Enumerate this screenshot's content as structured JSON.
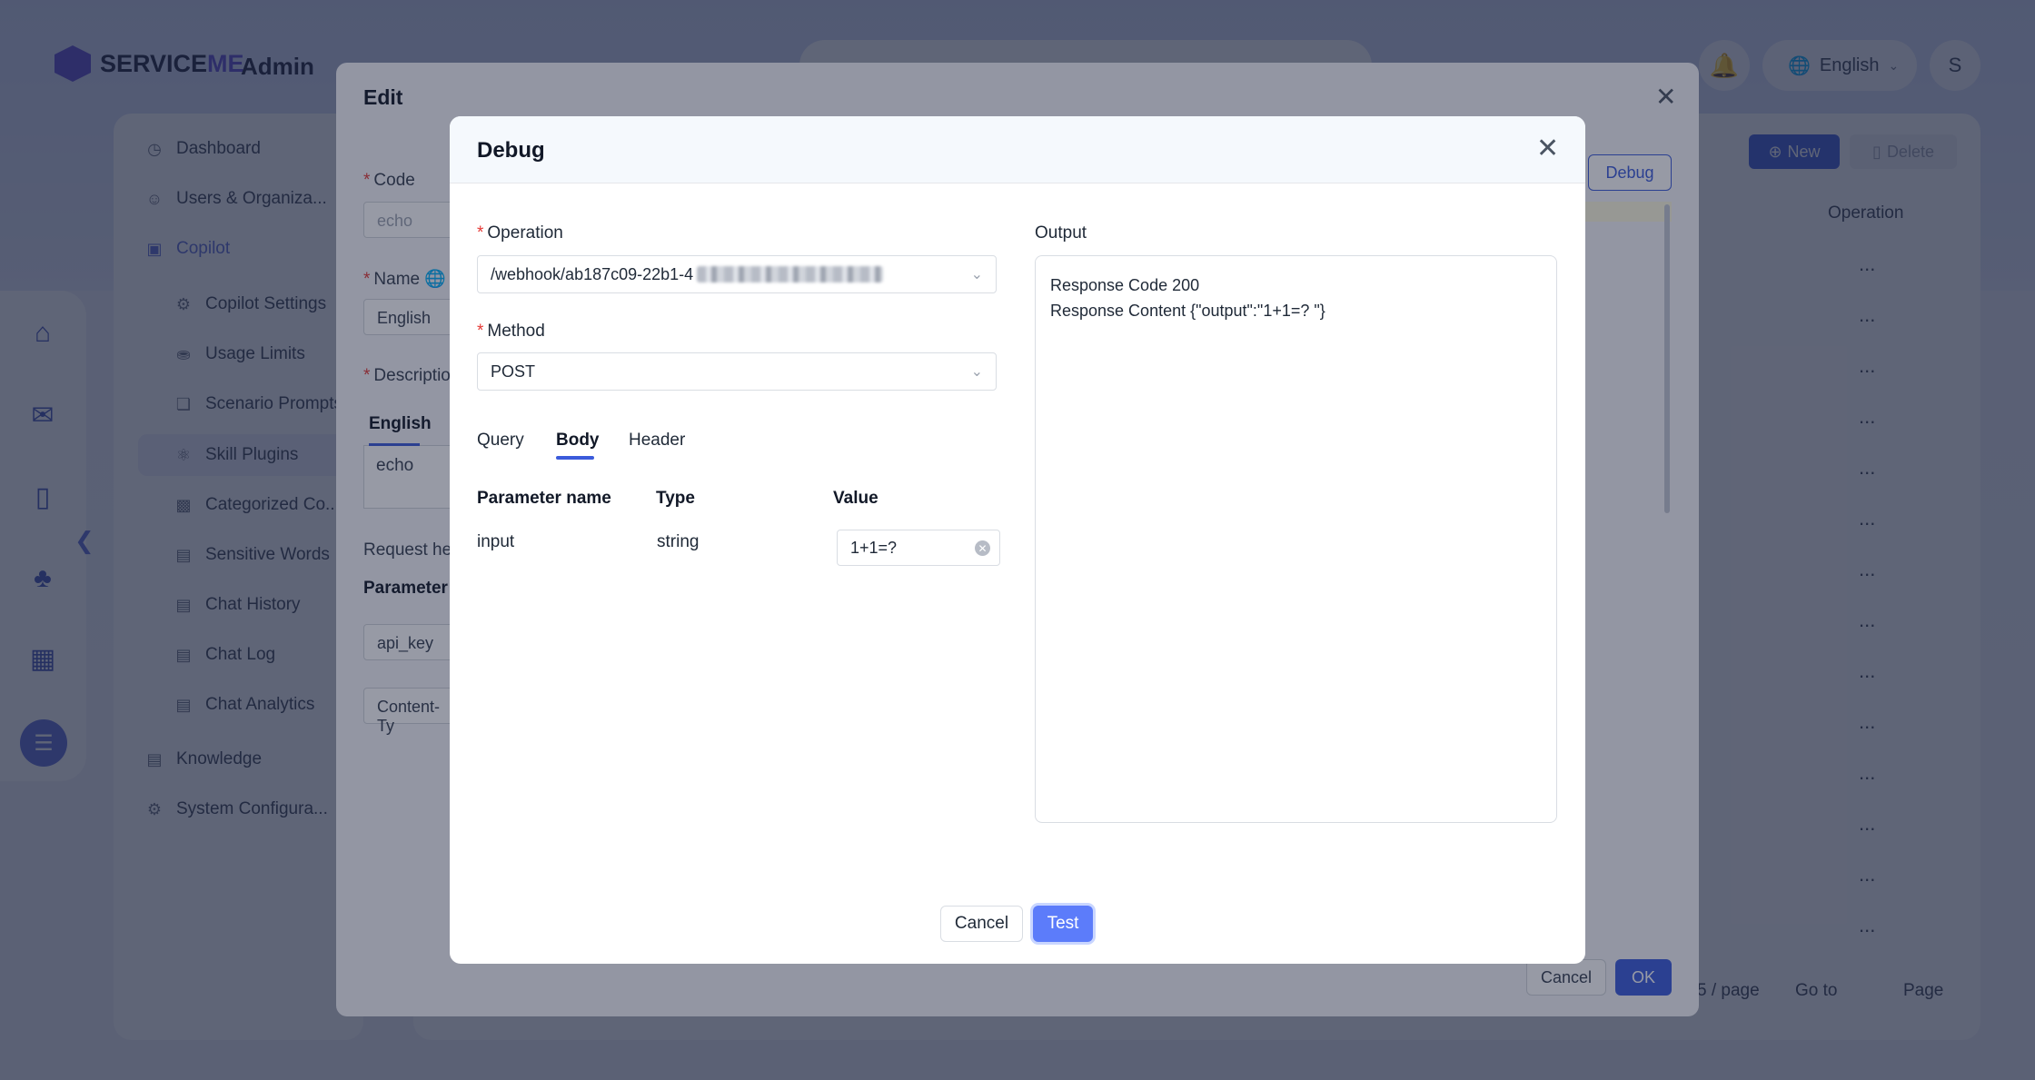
{
  "app": {
    "logo_prefix": "SERVICE",
    "logo_suffix": "ME",
    "admin_label": "Admin",
    "language": "English",
    "avatar_initial": "S"
  },
  "sidebar": {
    "items": [
      {
        "label": "Dashboard",
        "icon": "dashboard-icon"
      },
      {
        "label": "Users & Organiza...",
        "icon": "users-icon"
      },
      {
        "label": "Copilot",
        "icon": "copilot-icon"
      },
      {
        "label": "Copilot Settings",
        "icon": "settings-icon"
      },
      {
        "label": "Usage Limits",
        "icon": "lock-icon"
      },
      {
        "label": "Scenario Prompts",
        "icon": "prompt-icon"
      },
      {
        "label": "Skill Plugins",
        "icon": "plugin-icon"
      },
      {
        "label": "Categorized Co...",
        "icon": "chat-icon"
      },
      {
        "label": "Sensitive Words",
        "icon": "words-icon"
      },
      {
        "label": "Chat History",
        "icon": "history-icon"
      },
      {
        "label": "Chat Log",
        "icon": "log-icon"
      },
      {
        "label": "Chat Analytics",
        "icon": "analytics-icon"
      },
      {
        "label": "Knowledge",
        "icon": "knowledge-icon"
      },
      {
        "label": "System Configura...",
        "icon": "gear-icon"
      }
    ]
  },
  "content": {
    "new_label": "New",
    "delete_label": "Delete",
    "operation_header": "Operation",
    "row_action": "...",
    "pager": {
      "per_page": "5 / page",
      "goto": "Go to",
      "page": "Page"
    }
  },
  "edit_modal": {
    "title": "Edit",
    "code_label": "Code",
    "code_value": "echo",
    "name_label": "Name",
    "name_value": "English",
    "description_label": "Descriptio",
    "lang_tab": "English",
    "description_value": "echo",
    "request_header_label": "Request hea",
    "param_label": "Parameter n",
    "param_1": "api_key",
    "param_2": "Content-Ty",
    "debug_label": "Debug",
    "cancel_label": "Cancel",
    "ok_label": "OK"
  },
  "debug": {
    "title": "Debug",
    "operation_label": "Operation",
    "operation_value": "/webhook/ab187c09-22b1-4",
    "method_label": "Method",
    "method_value": "POST",
    "tabs": [
      "Query",
      "Body",
      "Header"
    ],
    "active_tab": "Body",
    "table": {
      "headers": [
        "Parameter name",
        "Type",
        "Value"
      ],
      "rows": [
        {
          "name": "input",
          "type": "string",
          "value": "1+1=?"
        }
      ]
    },
    "output_label": "Output",
    "output_line1": "Response Code 200",
    "output_line2": "Response Content {\"output\":\"1+1=?  \"}",
    "cancel_label": "Cancel",
    "test_label": "Test"
  },
  "colors": {
    "primary": "#3b5bdb",
    "test_button": "#5c7cfa",
    "required": "#e53935"
  }
}
